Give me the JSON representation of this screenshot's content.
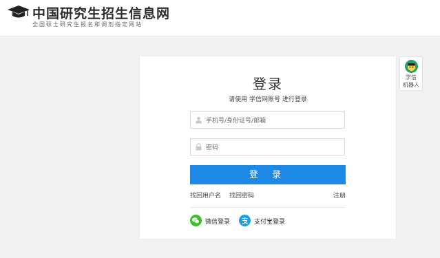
{
  "header": {
    "title": "中国研究生招生信息网",
    "subtitle": "全国硕士研究生报名和调剂指定网站",
    "logo_icon": "graduation-cap-icon"
  },
  "login": {
    "title": "登录",
    "subtitle": "请使用 学信网账号 进行登录",
    "username_placeholder": "手机号/身份证号/邮箱",
    "username_value": "",
    "password_placeholder": "密码",
    "password_value": "",
    "submit_label": "登 录",
    "forgot_username": "找回用户名",
    "forgot_password": "找回密码",
    "register": "注册",
    "wechat_label": "微信登录",
    "alipay_label": "支付宝登录"
  },
  "robot": {
    "line1": "学信",
    "line2": "机器人"
  },
  "colors": {
    "primary": "#1e88e5",
    "wechat": "#3fc127",
    "alipay": "#1a9fe0",
    "background": "#f1f1f1"
  }
}
